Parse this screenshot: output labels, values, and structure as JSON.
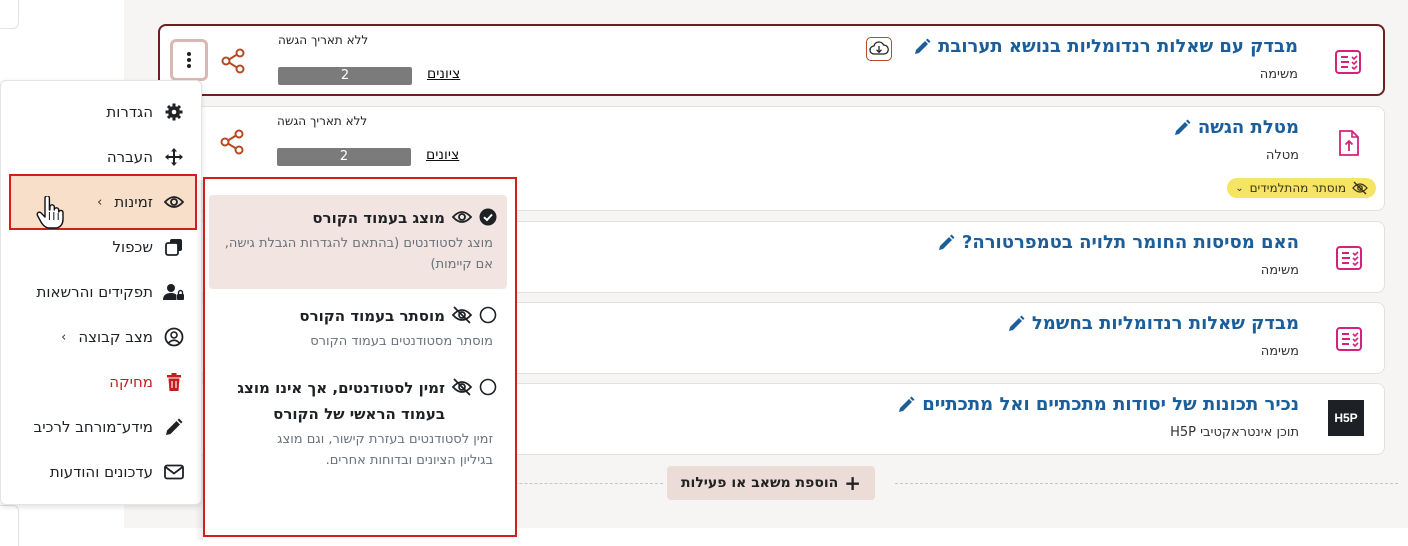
{
  "activities": [
    {
      "title": "מבדק עם שאלות רנדומליות בנושא תערובת",
      "type": "משימה",
      "icon": "assignment-icon",
      "due": "ללא תאריך הגשה",
      "grades_label": "ציונים",
      "grade_count": "2",
      "highlighted": true
    },
    {
      "title": "מטלת הגשה",
      "type": "מטלה",
      "icon": "upload-file-icon",
      "due": "ללא תאריך הגשה",
      "grades_label": "ציונים",
      "grade_count": "2",
      "badge": "מוסתר מהתלמידים"
    },
    {
      "title": "האם מסיסות החומר תלויה בטמפרטורה?",
      "type": "משימה",
      "icon": "assignment-icon"
    },
    {
      "title": "מבדק שאלות רנדומליות בחשמל",
      "type": "משימה",
      "icon": "assignment-icon"
    },
    {
      "title": "נכיר תכונות של יסודות מתכתיים ואל מתכתיים",
      "type": "תוכן אינטראקטיבי H5P",
      "icon": "h5p-icon",
      "icon_text": "H5P"
    }
  ],
  "add_activity_label": "הוספת משאב או פעילות",
  "context_menu": {
    "items": [
      {
        "label": "הגדרות",
        "icon": "gear-icon"
      },
      {
        "label": "העברה",
        "icon": "move-icon"
      },
      {
        "label": "זמינות",
        "icon": "eye-icon",
        "chevron": "›"
      },
      {
        "label": "שכפול",
        "icon": "copy-icon"
      },
      {
        "label": "תפקידים והרשאות",
        "icon": "user-lock-icon"
      },
      {
        "label": "מצב קבוצה",
        "icon": "user-circle-icon",
        "chevron": "›"
      },
      {
        "label": "מחיקה",
        "icon": "trash-icon"
      },
      {
        "label": "מידע־מורחב לרכיב",
        "icon": "pencil-icon"
      },
      {
        "label": "עדכונים והודעות",
        "icon": "envelope-icon"
      }
    ]
  },
  "availability_submenu": {
    "options": [
      {
        "title": "מוצג בעמוד הקורס",
        "desc": "מוצג לסטודנטים (בהתאם להגדרות הגבלת גישה, אם קיימות)",
        "selected": true
      },
      {
        "title": "מוסתר בעמוד הקורס",
        "desc": "מוסתר מסטודנטים בעמוד הקורס",
        "selected": false
      },
      {
        "title": "זמין לסטודנטים, אך אינו מוצג בעמוד הראשי של הקורס",
        "desc": "זמין לסטודנטים בעזרת קישור, וגם מוצג בגיליון הציונים ובדוחות אחרים.",
        "selected": false
      }
    ]
  },
  "colors": {
    "title_blue": "#1b5e9a",
    "accent_pink": "#d6217a",
    "share_orange": "#b64a25",
    "danger_red": "#c41e1e",
    "badge_yellow": "#f6e564",
    "highlight_border": "#d31e1e"
  }
}
